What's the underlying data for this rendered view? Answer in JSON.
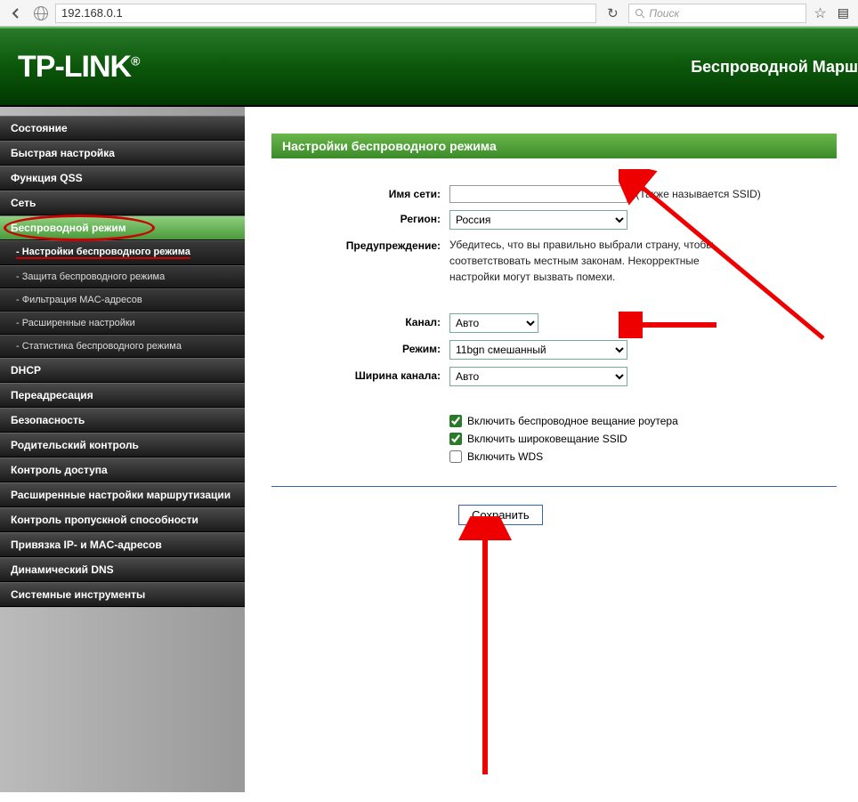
{
  "browser": {
    "url": "192.168.0.1",
    "search_placeholder": "Поиск"
  },
  "header": {
    "logo": "TP-LINK",
    "product": "Беспроводной Марш"
  },
  "sidebar": {
    "items": [
      {
        "label": "Состояние"
      },
      {
        "label": "Быстрая настройка"
      },
      {
        "label": "Функция QSS"
      },
      {
        "label": "Сеть"
      },
      {
        "label": "Беспроводной режим",
        "active": true,
        "sub": [
          {
            "label": "- Настройки беспроводного режима",
            "active": true
          },
          {
            "label": "- Защита беспроводного режима"
          },
          {
            "label": "- Фильтрация MAC-адресов"
          },
          {
            "label": "- Расширенные настройки"
          },
          {
            "label": "- Статистика беспроводного режима"
          }
        ]
      },
      {
        "label": "DHCP"
      },
      {
        "label": "Переадресация"
      },
      {
        "label": "Безопасность"
      },
      {
        "label": "Родительский контроль"
      },
      {
        "label": "Контроль доступа"
      },
      {
        "label": "Расширенные настройки маршрутизации"
      },
      {
        "label": "Контроль пропускной способности"
      },
      {
        "label": "Привязка IP- и MAC-адресов"
      },
      {
        "label": "Динамический DNS"
      },
      {
        "label": "Системные инструменты"
      }
    ]
  },
  "page": {
    "title": "Настройки беспроводного режима",
    "ssid_label": "Имя сети:",
    "ssid_value": "",
    "ssid_hint": "(Также называется SSID)",
    "region_label": "Регион:",
    "region_value": "Россия",
    "warning_label": "Предупреждение:",
    "warning_text": "Убедитесь, что вы правильно выбрали страну, чтобы соответствовать местным законам. Некорректные настройки могут вызвать помехи.",
    "channel_label": "Канал:",
    "channel_value": "Авто",
    "mode_label": "Режим:",
    "mode_value": "11bgn смешанный",
    "width_label": "Ширина канала:",
    "width_value": "Авто",
    "cb_broadcast": "Включить беспроводное вещание роутера",
    "cb_ssid": "Включить широковещание SSID",
    "cb_wds": "Включить WDS",
    "save": "Сохранить"
  }
}
